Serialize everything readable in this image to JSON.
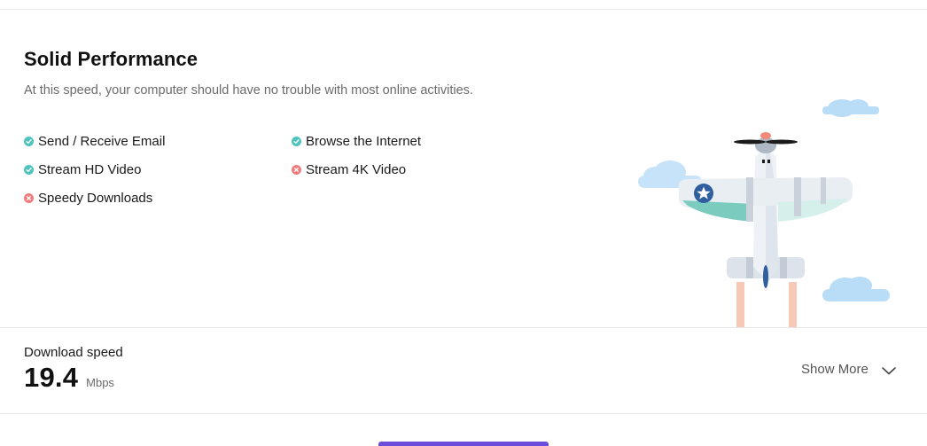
{
  "result": {
    "title": "Solid Performance",
    "description": "At this speed, your computer should have no trouble with most online activities."
  },
  "features": [
    {
      "label": "Send / Receive Email",
      "status": "ok"
    },
    {
      "label": "Browse the Internet",
      "status": "ok"
    },
    {
      "label": "Stream HD Video",
      "status": "ok"
    },
    {
      "label": "Stream 4K Video",
      "status": "no"
    },
    {
      "label": "Speedy Downloads",
      "status": "no"
    }
  ],
  "download": {
    "label": "Download speed",
    "value": "19.4",
    "unit": "Mbps"
  },
  "actions": {
    "show_more": "Show More"
  },
  "colors": {
    "ok": "#4fc3bd",
    "no": "#f27c7c",
    "accent": "#6a4ddb",
    "cloud": "#b9dcf7"
  },
  "icons": {
    "ok": "check-circle-icon",
    "no": "x-circle-icon",
    "show_more": "chevron-down-icon",
    "illustration": "airplane-illustration"
  }
}
